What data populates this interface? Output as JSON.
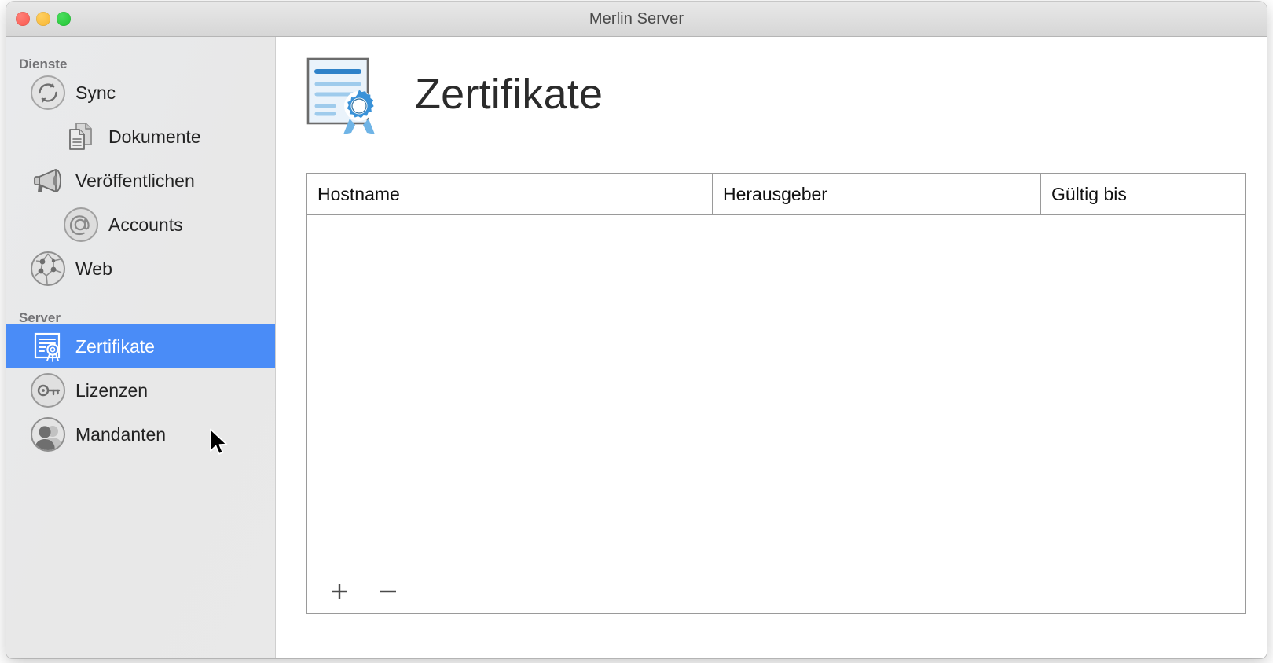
{
  "window": {
    "title": "Merlin Server",
    "controls": [
      {
        "name": "close-button",
        "label": "Close"
      },
      {
        "name": "minimize-button",
        "label": "Minimize"
      },
      {
        "name": "zoom-button",
        "label": "Zoom"
      }
    ]
  },
  "sidebar": {
    "sections": [
      {
        "label": "Dienste",
        "items": [
          {
            "label": "Sync",
            "icon": "sync-icon",
            "indent": false,
            "selected": false
          },
          {
            "label": "Dokumente",
            "icon": "documents-icon",
            "indent": true,
            "selected": false
          },
          {
            "label": "Veröffentlichen",
            "icon": "megaphone-icon",
            "indent": false,
            "selected": false
          },
          {
            "label": "Accounts",
            "icon": "at-sign-icon",
            "indent": true,
            "selected": false
          },
          {
            "label": "Web",
            "icon": "globe-icon",
            "indent": false,
            "selected": false
          }
        ]
      },
      {
        "label": "Server",
        "items": [
          {
            "label": "Zertifikate",
            "icon": "certificate-icon",
            "indent": false,
            "selected": true
          },
          {
            "label": "Lizenzen",
            "icon": "key-icon",
            "indent": false,
            "selected": false
          },
          {
            "label": "Mandanten",
            "icon": "clients-icon",
            "indent": false,
            "selected": false
          }
        ]
      }
    ],
    "selection_color": "#4a8cf7"
  },
  "main": {
    "page_icon": "certificate-hero-icon",
    "page_title": "Zertifikate",
    "table": {
      "columns": [
        "Hostname",
        "Herausgeber",
        "Gültig bis"
      ],
      "rows": [],
      "empty": true
    },
    "toolbar": {
      "add_label": "+",
      "remove_label": "−",
      "add_icon": "plus-icon",
      "remove_icon": "minus-icon"
    }
  },
  "pointer": {
    "icon": "mouse-arrow-cursor"
  }
}
